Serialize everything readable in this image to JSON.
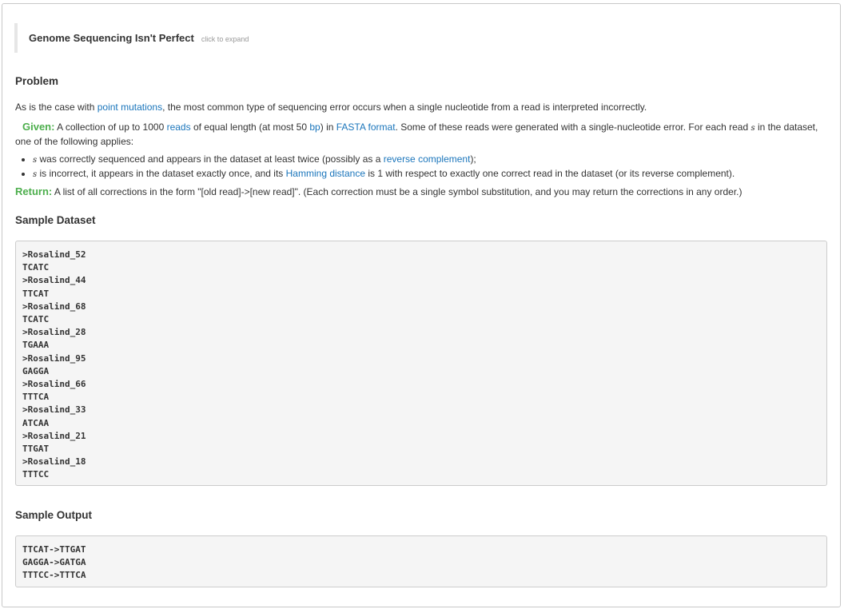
{
  "expander": {
    "title": "Genome Sequencing Isn't Perfect",
    "hint": "click to expand"
  },
  "problem": {
    "heading": "Problem",
    "intro_before": "As is the case with ",
    "intro_link": "point mutations",
    "intro_after": ", the most common type of sequencing error occurs when a single nucleotide from a read is interpreted incorrectly."
  },
  "given": {
    "label": "Given:",
    "t1": " A collection of up to 1000 ",
    "link_reads": "reads",
    "t2": " of equal length (at most 50 ",
    "link_bp": "bp",
    "t3": ") in ",
    "link_fasta": "FASTA format",
    "t4": ". Some of these reads were generated with a single-nucleotide error. For each read ",
    "var": "s",
    "t5": " in the dataset, one of the following applies:"
  },
  "cases": [
    {
      "var": "s",
      "before": " was correctly sequenced and appears in the dataset at least twice (possibly as a ",
      "link": "reverse complement",
      "after": ");"
    },
    {
      "var": "s",
      "before": " is incorrect, it appears in the dataset exactly once, and its ",
      "link": "Hamming distance",
      "after": " is 1 with respect to exactly one correct read in the dataset (or its reverse complement)."
    }
  ],
  "return": {
    "label": "Return:",
    "text": " A list of all corrections in the form \"[old read]->[new read]\". (Each correction must be a single symbol substitution, and you may return the corrections in any order.)"
  },
  "sample_dataset": {
    "heading": "Sample Dataset",
    "lines": [
      ">Rosalind_52",
      "TCATC",
      ">Rosalind_44",
      "TTCAT",
      ">Rosalind_68",
      "TCATC",
      ">Rosalind_28",
      "TGAAA",
      ">Rosalind_95",
      "GAGGA",
      ">Rosalind_66",
      "TTTCA",
      ">Rosalind_33",
      "ATCAA",
      ">Rosalind_21",
      "TTGAT",
      ">Rosalind_18",
      "TTTCC"
    ]
  },
  "sample_output": {
    "heading": "Sample Output",
    "lines": [
      "TTCAT->TTGAT",
      "GAGGA->GATGA",
      "TTTCC->TTTCA"
    ]
  },
  "colors": {
    "link": "#1a75bb",
    "label_green": "#4cae4c",
    "code_bg": "#f5f5f5"
  }
}
